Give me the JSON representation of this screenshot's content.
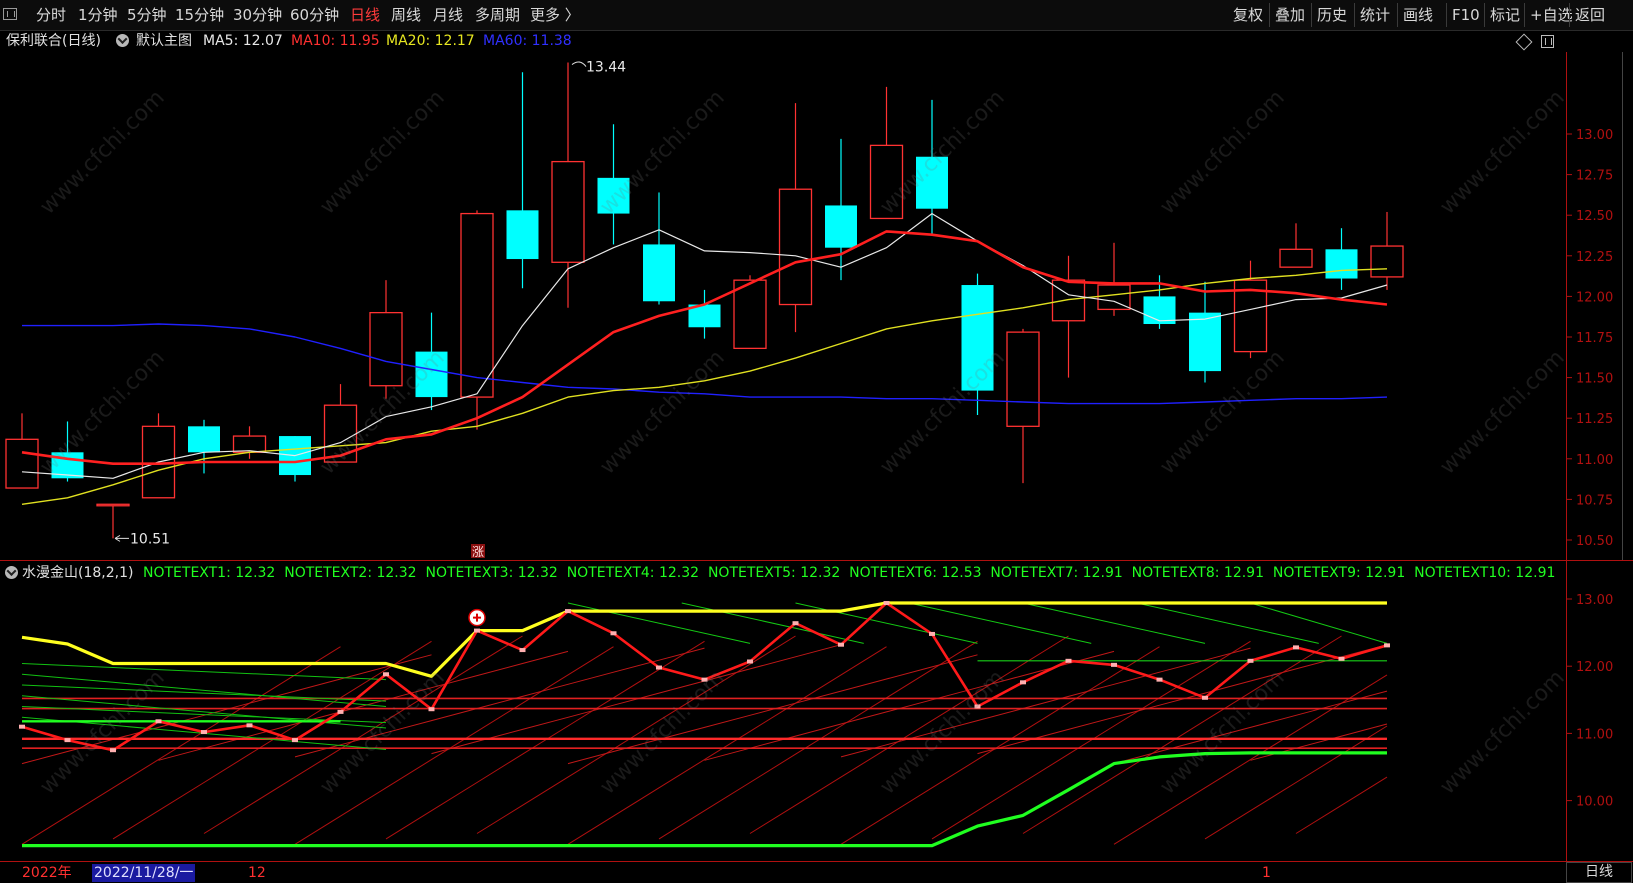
{
  "toolbar": {
    "periods": [
      {
        "label": "分时",
        "x": 36,
        "active": false
      },
      {
        "label": "1分钟",
        "x": 78,
        "active": false
      },
      {
        "label": "5分钟",
        "x": 127,
        "active": false
      },
      {
        "label": "15分钟",
        "x": 175,
        "active": false
      },
      {
        "label": "30分钟",
        "x": 233,
        "active": false
      },
      {
        "label": "60分钟",
        "x": 290,
        "active": false
      },
      {
        "label": "日线",
        "x": 350,
        "active": true
      },
      {
        "label": "周线",
        "x": 391,
        "active": false
      },
      {
        "label": "月线",
        "x": 433,
        "active": false
      },
      {
        "label": "多周期",
        "x": 475,
        "active": false
      },
      {
        "label": "更多 〉",
        "x": 530,
        "active": false
      }
    ],
    "actions": [
      "复权",
      "叠加",
      "历史",
      "统计",
      "画线",
      "F10",
      "标记",
      "+自选",
      "返回"
    ]
  },
  "main_header": {
    "stock": "保利联合(日线)",
    "template": "默认主图",
    "ma5": "MA5: 12.07",
    "ma10": "MA10: 11.95",
    "ma20": "MA20: 12.17",
    "ma60": "MA60: 11.38"
  },
  "indicator_header": {
    "name": "水漫金山(18,2,1)",
    "notes": "NOTETEXT1: 12.32  NOTETEXT2: 12.32  NOTETEXT3: 12.32  NOTETEXT4: 12.32  NOTETEXT5: 12.32  NOTETEXT6: 12.53  NOTETEXT7: 12.91  NOTETEXT8: 12.91  NOTETEXT9: 12.91  NOTETEXT10: 12.91"
  },
  "status_bar": {
    "year": "2022年",
    "cursor_date": "2022/11/28/一",
    "month_dec": "12",
    "month_jan": "1",
    "period_button": "日线"
  },
  "watermark": "www.cfchi.com",
  "colors": {
    "up": "#ff3232",
    "down": "#00ffff",
    "ma5": "#e8e8e8",
    "ma10": "#ff2020",
    "ma20": "#e0e020",
    "ma60": "#2020ff",
    "axis": "#b01010",
    "green": "#20ff20",
    "yellow": "#ffff20"
  },
  "chart_data": [
    {
      "type": "candlestick",
      "title": "保利联合(日线)",
      "ylim": [
        10.4,
        13.5
      ],
      "yticks": [
        "13.00",
        "12.75",
        "12.50",
        "12.25",
        "12.00",
        "11.75",
        "11.50",
        "11.25",
        "11.00",
        "10.75",
        "10.50"
      ],
      "annotations": {
        "high": "13.44",
        "low": "10.51",
        "rise_marker": "涨"
      },
      "candles": [
        {
          "o": 10.82,
          "h": 11.28,
          "l": 10.82,
          "c": 11.12
        },
        {
          "o": 11.04,
          "h": 11.23,
          "l": 10.86,
          "c": 10.88
        },
        {
          "o": 10.72,
          "h": 10.72,
          "l": 10.51,
          "c": 10.72
        },
        {
          "o": 10.76,
          "h": 11.28,
          "l": 10.76,
          "c": 11.2
        },
        {
          "o": 11.2,
          "h": 11.24,
          "l": 10.91,
          "c": 11.04
        },
        {
          "o": 11.04,
          "h": 11.2,
          "l": 11.0,
          "c": 11.14
        },
        {
          "o": 11.14,
          "h": 11.14,
          "l": 10.86,
          "c": 10.9
        },
        {
          "o": 10.98,
          "h": 11.46,
          "l": 10.98,
          "c": 11.33
        },
        {
          "o": 11.45,
          "h": 12.1,
          "l": 11.37,
          "c": 11.9
        },
        {
          "o": 11.66,
          "h": 11.9,
          "l": 11.3,
          "c": 11.38
        },
        {
          "o": 11.38,
          "h": 12.53,
          "l": 11.18,
          "c": 12.51
        },
        {
          "o": 12.53,
          "h": 13.38,
          "l": 12.05,
          "c": 12.23
        },
        {
          "o": 12.21,
          "h": 13.44,
          "l": 11.93,
          "c": 12.83
        },
        {
          "o": 12.73,
          "h": 13.06,
          "l": 12.32,
          "c": 12.51
        },
        {
          "o": 12.32,
          "h": 12.64,
          "l": 11.95,
          "c": 11.97
        },
        {
          "o": 11.95,
          "h": 12.04,
          "l": 11.74,
          "c": 11.81
        },
        {
          "o": 11.68,
          "h": 12.13,
          "l": 11.68,
          "c": 12.1
        },
        {
          "o": 11.95,
          "h": 13.19,
          "l": 11.78,
          "c": 12.66
        },
        {
          "o": 12.56,
          "h": 12.97,
          "l": 12.1,
          "c": 12.3
        },
        {
          "o": 12.48,
          "h": 13.29,
          "l": 12.48,
          "c": 12.93
        },
        {
          "o": 12.86,
          "h": 13.21,
          "l": 12.38,
          "c": 12.54
        },
        {
          "o": 12.07,
          "h": 12.14,
          "l": 11.27,
          "c": 11.42
        },
        {
          "o": 11.2,
          "h": 11.8,
          "l": 10.85,
          "c": 11.78
        },
        {
          "o": 11.85,
          "h": 12.25,
          "l": 11.5,
          "c": 12.1
        },
        {
          "o": 11.92,
          "h": 12.33,
          "l": 11.88,
          "c": 12.07
        },
        {
          "o": 12.0,
          "h": 12.13,
          "l": 11.8,
          "c": 11.83
        },
        {
          "o": 11.9,
          "h": 12.09,
          "l": 11.47,
          "c": 11.54
        },
        {
          "o": 11.66,
          "h": 12.22,
          "l": 11.62,
          "c": 12.1
        },
        {
          "o": 12.18,
          "h": 12.45,
          "l": 12.18,
          "c": 12.29
        },
        {
          "o": 12.29,
          "h": 12.42,
          "l": 12.04,
          "c": 12.11
        },
        {
          "o": 12.12,
          "h": 12.52,
          "l": 12.04,
          "c": 12.31
        }
      ],
      "ma5": [
        10.92,
        10.9,
        10.88,
        10.98,
        11.04,
        11.05,
        11.02,
        11.1,
        11.26,
        11.32,
        11.4,
        11.82,
        12.17,
        12.3,
        12.41,
        12.28,
        12.27,
        12.25,
        12.18,
        12.3,
        12.51,
        12.34,
        12.19,
        12.01,
        11.97,
        11.85,
        11.86,
        11.92,
        11.98,
        11.99,
        12.07
      ],
      "ma10": [
        11.04,
        11.0,
        10.97,
        10.97,
        10.98,
        10.98,
        10.98,
        11.02,
        11.12,
        11.15,
        11.25,
        11.38,
        11.58,
        11.78,
        11.88,
        11.95,
        12.08,
        12.21,
        12.26,
        12.4,
        12.38,
        12.34,
        12.18,
        12.09,
        12.08,
        12.08,
        12.03,
        12.04,
        12.02,
        11.98,
        11.95
      ],
      "ma20": [
        10.72,
        10.76,
        10.84,
        10.93,
        11.0,
        11.04,
        11.06,
        11.08,
        11.1,
        11.17,
        11.2,
        11.28,
        11.38,
        11.42,
        11.44,
        11.48,
        11.54,
        11.62,
        11.71,
        11.8,
        11.85,
        11.89,
        11.93,
        11.98,
        12.01,
        12.04,
        12.08,
        12.11,
        12.13,
        12.16,
        12.17
      ],
      "ma60": [
        11.82,
        11.82,
        11.82,
        11.83,
        11.82,
        11.8,
        11.75,
        11.68,
        11.6,
        11.55,
        11.5,
        11.47,
        11.44,
        11.43,
        11.41,
        11.4,
        11.38,
        11.38,
        11.38,
        11.37,
        11.37,
        11.36,
        11.35,
        11.34,
        11.34,
        11.34,
        11.35,
        11.36,
        11.37,
        11.37,
        11.38
      ]
    },
    {
      "type": "line",
      "title": "水漫金山(18,2,1)",
      "ylim": [
        9.2,
        13.2
      ],
      "yticks": [
        "13.00",
        "12.00",
        "11.00",
        "10.00"
      ],
      "series": [
        {
          "name": "red",
          "values": [
            11.1,
            10.9,
            10.75,
            11.18,
            11.02,
            11.12,
            10.9,
            11.32,
            11.88,
            11.36,
            12.53,
            12.24,
            12.82,
            12.49,
            11.98,
            11.8,
            12.07,
            12.64,
            12.32,
            12.94,
            12.48,
            11.4,
            11.76,
            12.08,
            12.02,
            11.8,
            11.53,
            12.08,
            12.28,
            12.11,
            12.31
          ]
        },
        {
          "name": "yellow",
          "values": [
            12.43,
            12.33,
            12.04,
            12.04,
            12.04,
            12.04,
            12.04,
            12.04,
            12.04,
            11.85,
            12.53,
            12.53,
            12.82,
            12.82,
            12.82,
            12.82,
            12.82,
            12.82,
            12.82,
            12.94,
            12.94,
            12.94,
            12.94,
            12.94,
            12.94,
            12.94,
            12.94,
            12.94,
            12.94,
            12.94,
            12.94
          ]
        },
        {
          "name": "green",
          "values": [
            9.33,
            9.33,
            9.33,
            9.33,
            9.33,
            9.33,
            9.33,
            9.33,
            9.33,
            9.33,
            9.33,
            9.33,
            9.33,
            9.33,
            9.33,
            9.33,
            9.33,
            9.33,
            9.33,
            9.33,
            9.33,
            9.62,
            9.78,
            10.16,
            10.55,
            10.65,
            10.7,
            10.71,
            10.71,
            10.71,
            10.71
          ]
        }
      ]
    }
  ]
}
